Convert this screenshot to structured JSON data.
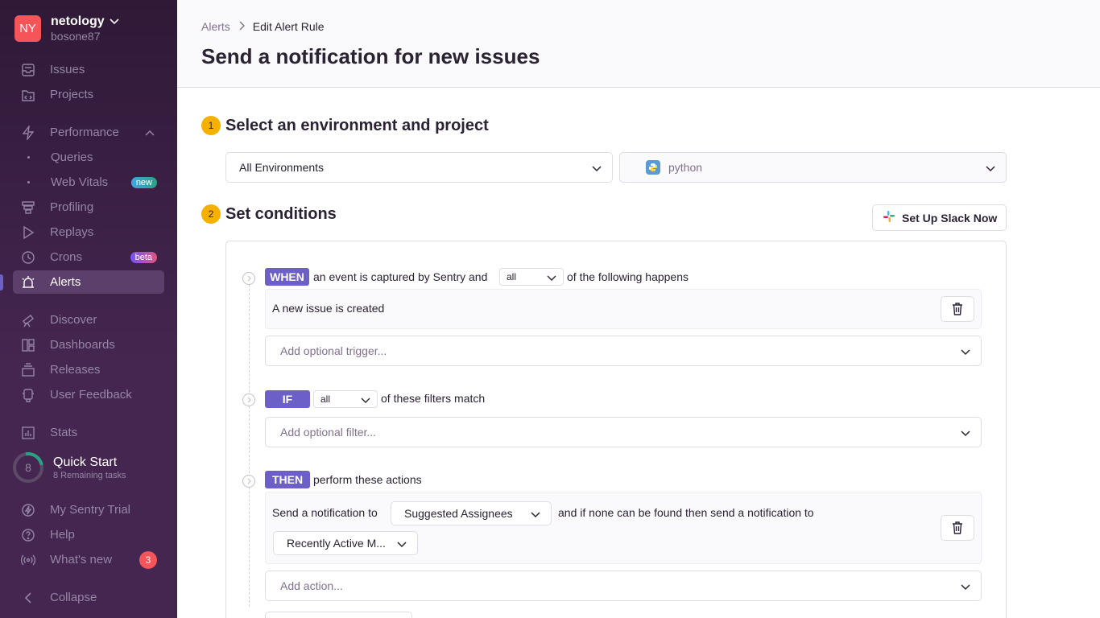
{
  "org": {
    "initials": "NY",
    "name": "netology",
    "user": "bosone87"
  },
  "sidebar": {
    "items": [
      {
        "label": "Issues"
      },
      {
        "label": "Projects"
      },
      {
        "label": "Performance"
      },
      {
        "label": "Queries"
      },
      {
        "label": "Web Vitals",
        "badge": "new"
      },
      {
        "label": "Profiling"
      },
      {
        "label": "Replays"
      },
      {
        "label": "Crons",
        "badge": "beta"
      },
      {
        "label": "Alerts"
      },
      {
        "label": "Discover"
      },
      {
        "label": "Dashboards"
      },
      {
        "label": "Releases"
      },
      {
        "label": "User Feedback"
      },
      {
        "label": "Stats"
      },
      {
        "label": "My Sentry Trial"
      },
      {
        "label": "Help"
      },
      {
        "label": "What's new",
        "count": "3"
      },
      {
        "label": "Collapse"
      }
    ],
    "quickstart": {
      "count": "8",
      "title": "Quick Start",
      "sub": "8 Remaining tasks"
    }
  },
  "breadcrumb": {
    "parent": "Alerts",
    "current": "Edit Alert Rule"
  },
  "page_title": "Send a notification for new issues",
  "step1": {
    "num": "1",
    "title": "Select an environment and project",
    "environment": "All Environments",
    "project": "python"
  },
  "step2": {
    "num": "2",
    "title": "Set conditions",
    "slack_button": "Set Up Slack Now"
  },
  "when": {
    "pill": "WHEN",
    "text_before": "an event is captured by Sentry and",
    "match": "all",
    "text_after": "of the following happens",
    "condition": "A new issue is created",
    "add_placeholder": "Add optional trigger..."
  },
  "if": {
    "pill": "IF",
    "match": "all",
    "text_after": "of these filters match",
    "add_placeholder": "Add optional filter..."
  },
  "then": {
    "pill": "THEN",
    "text": "perform these actions",
    "action_prefix": "Send a notification to",
    "target": "Suggested Assignees",
    "fallback_text": "and if none can be found then send a notification to",
    "fallback": "Recently Active M...",
    "add_placeholder": "Add action..."
  },
  "colors": {
    "sidebar_bg": "#2f1937",
    "accent": "#6c5fc7",
    "step_badge": "#f5b000",
    "alert_red": "#f55459"
  }
}
